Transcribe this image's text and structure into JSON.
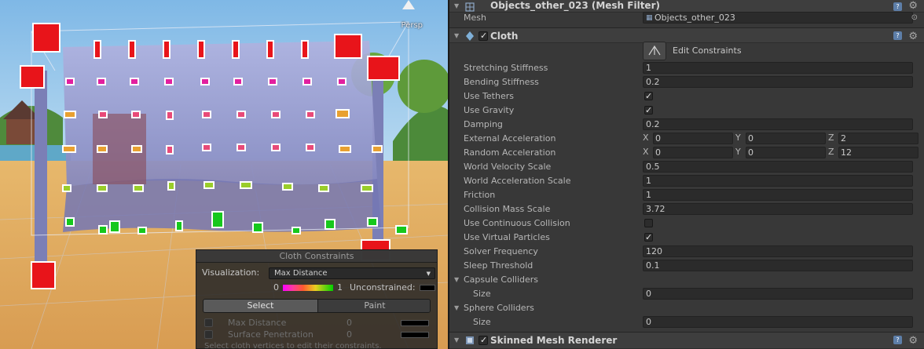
{
  "scene": {
    "persp_label": "Persp"
  },
  "cloth_constraints": {
    "title": "Cloth Constraints",
    "visualization_label": "Visualization:",
    "visualization_value": "Max Distance",
    "range_min": "0",
    "range_max": "1",
    "unconstrained_label": "Unconstrained:",
    "select_label": "Select",
    "paint_label": "Paint",
    "max_distance_label": "Max Distance",
    "max_distance_value": "0",
    "surface_penetration_label": "Surface Penetration",
    "surface_penetration_value": "0",
    "hint": "Select cloth vertices to edit their constraints."
  },
  "inspector": {
    "mesh_filter": {
      "title": "Objects_other_023 (Mesh Filter)",
      "mesh_label": "Mesh",
      "mesh_value": "Objects_other_023"
    },
    "cloth": {
      "title": "Cloth",
      "edit_constraints_label": "Edit Constraints",
      "stretching_stiffness_label": "Stretching Stiffness",
      "stretching_stiffness": "1",
      "bending_stiffness_label": "Bending Stiffness",
      "bending_stiffness": "0.2",
      "use_tethers_label": "Use Tethers",
      "use_tethers": true,
      "use_gravity_label": "Use Gravity",
      "use_gravity": true,
      "damping_label": "Damping",
      "damping": "0.2",
      "external_acceleration_label": "External Acceleration",
      "external_acceleration": {
        "x": "0",
        "y": "0",
        "z": "2"
      },
      "random_acceleration_label": "Random Acceleration",
      "random_acceleration": {
        "x": "0",
        "y": "0",
        "z": "12"
      },
      "world_velocity_scale_label": "World Velocity Scale",
      "world_velocity_scale": "0.5",
      "world_acceleration_scale_label": "World Acceleration Scale",
      "world_acceleration_scale": "1",
      "friction_label": "Friction",
      "friction": "1",
      "collision_mass_scale_label": "Collision Mass Scale",
      "collision_mass_scale": "3.72",
      "use_continuous_collision_label": "Use Continuous Collision",
      "use_continuous_collision": false,
      "use_virtual_particles_label": "Use Virtual Particles",
      "use_virtual_particles": true,
      "solver_frequency_label": "Solver Frequency",
      "solver_frequency": "120",
      "sleep_threshold_label": "Sleep Threshold",
      "sleep_threshold": "0.1",
      "capsule_colliders_label": "Capsule Colliders",
      "capsule_size_label": "Size",
      "capsule_size": "0",
      "sphere_colliders_label": "Sphere Colliders",
      "sphere_size_label": "Size",
      "sphere_size": "0",
      "x_label": "X",
      "y_label": "Y",
      "z_label": "Z"
    },
    "skinned_mesh_renderer": {
      "title": "Skinned Mesh Renderer"
    }
  },
  "colors": {
    "inspector_bg": "#383838",
    "field_bg": "#2b2b2b",
    "help_icon": "#5d7ea8"
  }
}
